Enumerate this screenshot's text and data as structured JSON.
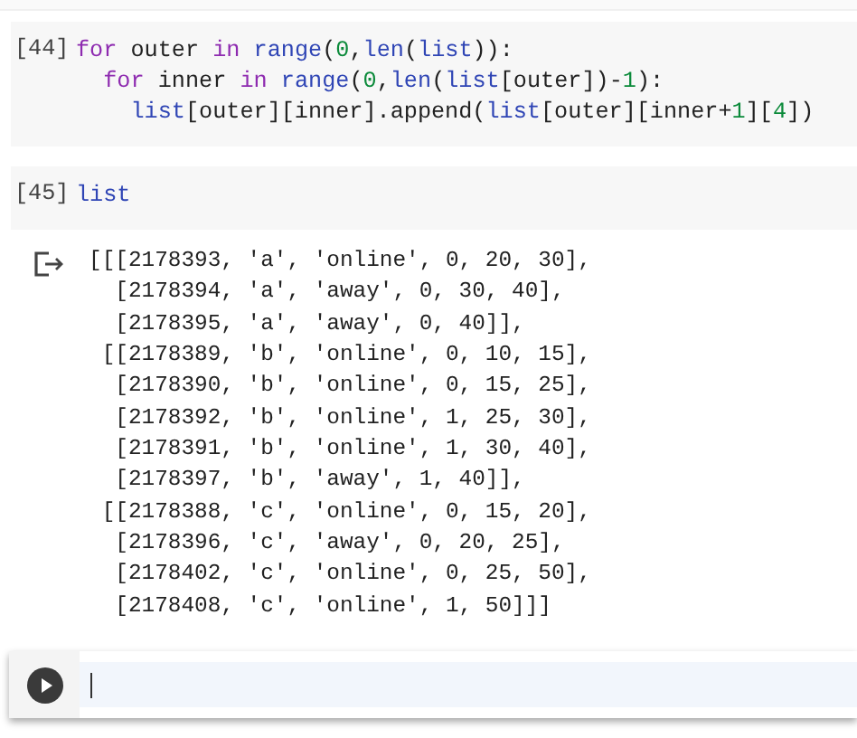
{
  "cells": [
    {
      "prompt": "[44]",
      "lines": [
        [
          {
            "kind": "keyword",
            "text": "for"
          },
          {
            "kind": "plain",
            "text": " outer "
          },
          {
            "kind": "keyword",
            "text": "in "
          },
          {
            "kind": "builtin",
            "text": "range"
          },
          {
            "kind": "plain",
            "text": "("
          },
          {
            "kind": "number",
            "text": "0"
          },
          {
            "kind": "plain",
            "text": ","
          },
          {
            "kind": "builtin",
            "text": "len"
          },
          {
            "kind": "plain",
            "text": "("
          },
          {
            "kind": "builtin",
            "text": "list"
          },
          {
            "kind": "plain",
            "text": ")):"
          }
        ],
        [
          {
            "kind": "keyword",
            "text": "  for"
          },
          {
            "kind": "plain",
            "text": " inner "
          },
          {
            "kind": "keyword",
            "text": "in "
          },
          {
            "kind": "builtin",
            "text": "range"
          },
          {
            "kind": "plain",
            "text": "("
          },
          {
            "kind": "number",
            "text": "0"
          },
          {
            "kind": "plain",
            "text": ","
          },
          {
            "kind": "builtin",
            "text": "len"
          },
          {
            "kind": "plain",
            "text": "("
          },
          {
            "kind": "builtin",
            "text": "list"
          },
          {
            "kind": "plain",
            "text": "[outer])-"
          },
          {
            "kind": "number",
            "text": "1"
          },
          {
            "kind": "plain",
            "text": "):"
          }
        ],
        [
          {
            "kind": "builtin",
            "text": "    list"
          },
          {
            "kind": "plain",
            "text": "[outer][inner].append("
          },
          {
            "kind": "builtin",
            "text": "list"
          },
          {
            "kind": "plain",
            "text": "[outer][inner+"
          },
          {
            "kind": "number",
            "text": "1"
          },
          {
            "kind": "plain",
            "text": "]["
          },
          {
            "kind": "number",
            "text": "4"
          },
          {
            "kind": "plain",
            "text": "])"
          }
        ]
      ]
    },
    {
      "prompt": "[45]",
      "lines": [
        [
          {
            "kind": "builtin",
            "text": "list"
          }
        ]
      ]
    }
  ],
  "output": [
    "[[[2178393, 'a', 'online', 0, 20, 30],",
    "  [2178394, 'a', 'away', 0, 30, 40],",
    "  [2178395, 'a', 'away', 0, 40]],",
    " [[2178389, 'b', 'online', 0, 10, 15],",
    "  [2178390, 'b', 'online', 0, 15, 25],",
    "  [2178392, 'b', 'online', 1, 25, 30],",
    "  [2178391, 'b', 'online', 1, 30, 40],",
    "  [2178397, 'b', 'away', 1, 40]],",
    " [[2178388, 'c', 'online', 0, 15, 20],",
    "  [2178396, 'c', 'away', 0, 20, 25],",
    "  [2178402, 'c', 'online', 0, 25, 50],",
    "  [2178408, 'c', 'online', 1, 50]]]"
  ]
}
